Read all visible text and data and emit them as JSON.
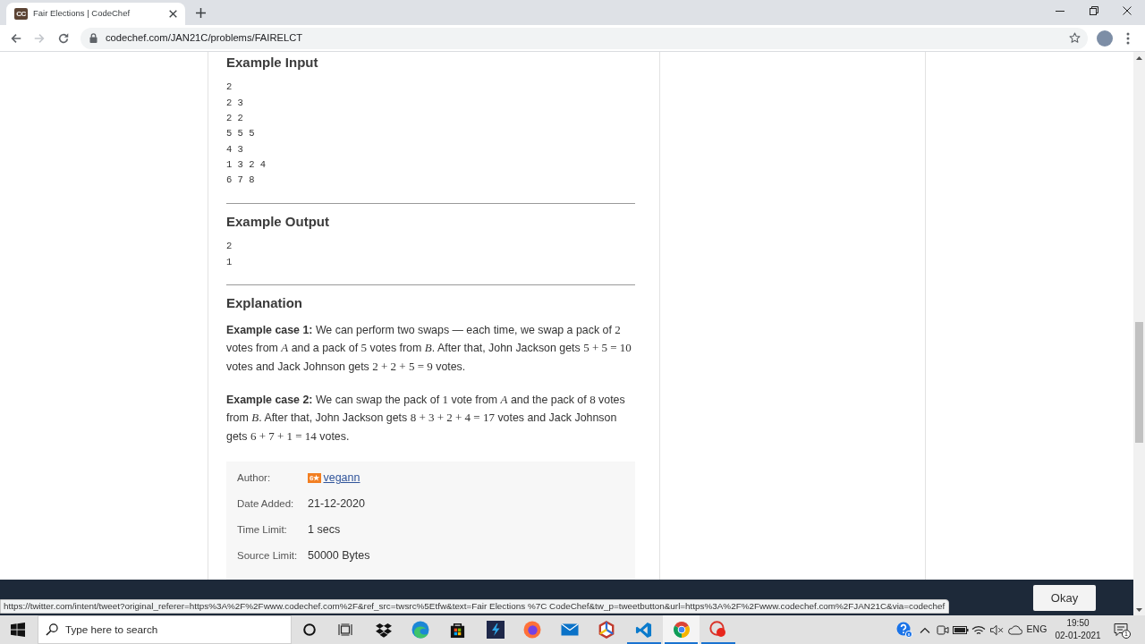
{
  "browser": {
    "tab": {
      "favicon": "CC",
      "title": "Fair Elections | CodeChef",
      "selected": true
    },
    "nav": [
      {
        "kind": "back",
        "disabled": false
      },
      {
        "kind": "forward",
        "disabled": true
      },
      {
        "kind": "reload",
        "disabled": false
      }
    ],
    "url": "codechef.com/JAN21C/problems/FAIRELCT"
  },
  "sections": [
    {
      "kind": "sample",
      "title": "Example Input",
      "lines": [
        "2",
        "2 3",
        "2 2",
        "5 5 5",
        "4 3",
        "1 3 2 4",
        "6 7 8"
      ]
    },
    {
      "kind": "sample",
      "title": "Example Output",
      "lines": [
        "2",
        "1"
      ]
    },
    {
      "kind": "explanation",
      "title": "Explanation",
      "paragraphs": [
        {
          "parts": [
            {
              "kind": "bold",
              "text": "Example case 1:"
            },
            {
              "kind": "text",
              "text": " We can perform two swaps — each time, we swap a pack of "
            },
            {
              "kind": "math",
              "text": "2"
            },
            {
              "kind": "text",
              "text": " votes from "
            },
            {
              "kind": "var",
              "text": "A"
            },
            {
              "kind": "text",
              "text": " and a pack of "
            },
            {
              "kind": "math",
              "text": "5"
            },
            {
              "kind": "text",
              "text": " votes from "
            },
            {
              "kind": "var",
              "text": "B"
            },
            {
              "kind": "text",
              "text": ". After that, John Jackson gets "
            },
            {
              "kind": "math",
              "text": "5 + 5 = 10"
            },
            {
              "kind": "text",
              "text": " votes and Jack Johnson gets "
            },
            {
              "kind": "math",
              "text": "2 + 2 + 5 = 9"
            },
            {
              "kind": "text",
              "text": " votes."
            }
          ]
        },
        {
          "parts": [
            {
              "kind": "bold",
              "text": "Example case 2:"
            },
            {
              "kind": "text",
              "text": " We can swap the pack of "
            },
            {
              "kind": "math",
              "text": "1"
            },
            {
              "kind": "text",
              "text": " vote from "
            },
            {
              "kind": "var",
              "text": "A"
            },
            {
              "kind": "text",
              "text": " and the pack of "
            },
            {
              "kind": "math",
              "text": "8"
            },
            {
              "kind": "text",
              "text": " votes from "
            },
            {
              "kind": "var",
              "text": "B"
            },
            {
              "kind": "text",
              "text": ". After that, John Jackson gets "
            },
            {
              "kind": "math",
              "text": "8 + 3 + 2 + 4 = 17"
            },
            {
              "kind": "text",
              "text": " votes and Jack Johnson gets "
            },
            {
              "kind": "math",
              "text": "6 + 7 + 1 = 14"
            },
            {
              "kind": "text",
              "text": " votes."
            }
          ]
        }
      ]
    }
  ],
  "details": [
    {
      "kind": "user",
      "label": "Author:",
      "badge": "6★",
      "value": "vegann"
    },
    {
      "kind": "text",
      "label": "Date Added:",
      "value": "21-12-2020"
    },
    {
      "kind": "text",
      "label": "Time Limit:",
      "value": "1 secs"
    },
    {
      "kind": "text",
      "label": "Source Limit:",
      "value": "50000 Bytes"
    }
  ],
  "cookie_banner": {
    "button": "Okay"
  },
  "status_url": "https://twitter.com/intent/tweet?original_referer=https%3A%2F%2Fwww.codechef.com%2F&ref_src=twsrc%5Etfw&text=Fair Elections %7C CodeChef&tw_p=tweetbutton&url=https%3A%2F%2Fwww.codechef.com%2FJAN21C&via=codechef",
  "taskbar": {
    "search": {
      "placeholder": "Type here to search"
    },
    "apps": [
      {
        "kind": "dropbox",
        "running": false,
        "selected": false
      },
      {
        "kind": "edge",
        "running": false,
        "selected": false
      },
      {
        "kind": "store",
        "running": false,
        "selected": false
      },
      {
        "kind": "lightning",
        "running": false,
        "selected": false
      },
      {
        "kind": "firefox",
        "running": false,
        "selected": false
      },
      {
        "kind": "mail",
        "running": false,
        "selected": false
      },
      {
        "kind": "hexagon",
        "running": false,
        "selected": false
      },
      {
        "kind": "vscode",
        "running": true,
        "selected": false
      },
      {
        "kind": "chrome",
        "running": true,
        "selected": true
      },
      {
        "kind": "recorder",
        "running": true,
        "selected": false
      }
    ],
    "tray": {
      "language": "ENG",
      "time": "19:50",
      "date": "02-01-2021",
      "notifications": "1"
    }
  }
}
